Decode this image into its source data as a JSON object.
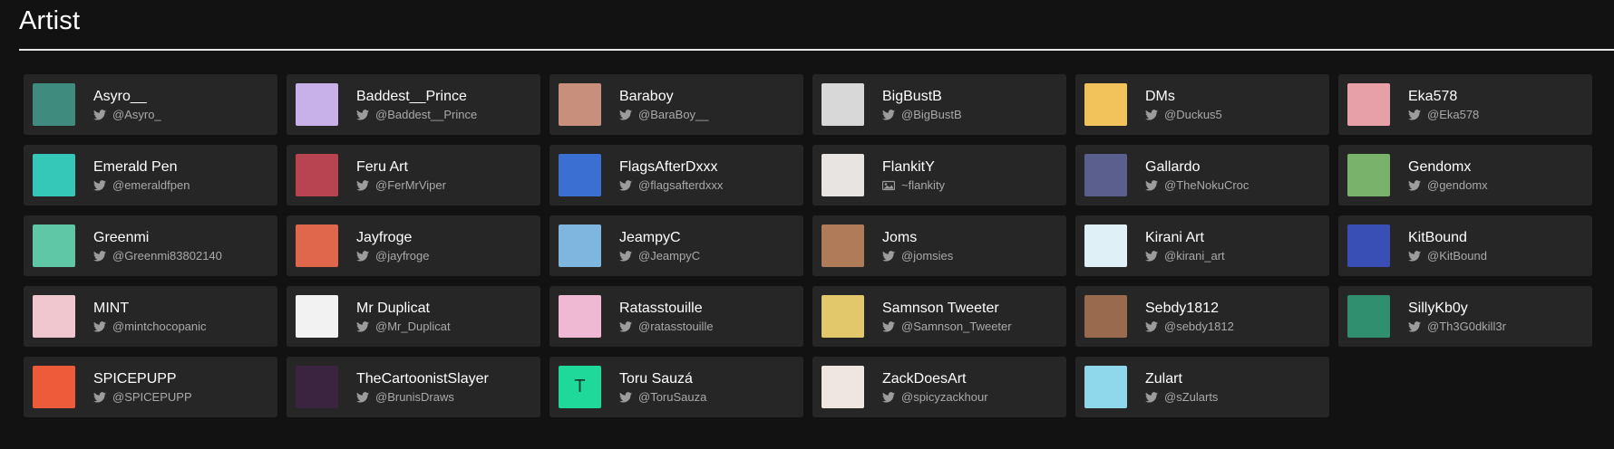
{
  "section": {
    "title": "Artist"
  },
  "colors": {
    "background": "#121212",
    "card": "#262626",
    "text": "#ffffff",
    "muted": "#a9a9a9"
  },
  "artists": [
    {
      "name": "Asyro__",
      "handle": "@Asyro_",
      "icon": "twitter-icon",
      "avatar": "#3f8b7d"
    },
    {
      "name": "Baddest__Prince",
      "handle": "@Baddest__Prince",
      "icon": "twitter-icon",
      "avatar": "#c8b0e8"
    },
    {
      "name": "Baraboy",
      "handle": "@BaraBoy__",
      "icon": "twitter-icon",
      "avatar": "#c98f7d"
    },
    {
      "name": "BigBustB",
      "handle": "@BigBustB",
      "icon": "twitter-icon",
      "avatar": "#d8d8d8"
    },
    {
      "name": "DMs",
      "handle": "@Duckus5",
      "icon": "twitter-icon",
      "avatar": "#f2c35a"
    },
    {
      "name": "Eka578",
      "handle": "@Eka578",
      "icon": "twitter-icon",
      "avatar": "#e7a0a8"
    },
    {
      "name": "Emerald Pen",
      "handle": "@emeraldfpen",
      "icon": "twitter-icon",
      "avatar": "#35c7b7"
    },
    {
      "name": "Feru Art",
      "handle": "@FerMrViper",
      "icon": "twitter-icon",
      "avatar": "#b84452"
    },
    {
      "name": "FlagsAfterDxxx",
      "handle": "@flagsafterdxxx",
      "icon": "twitter-icon",
      "avatar": "#3c6fd2"
    },
    {
      "name": "FlankitY",
      "handle": "~flankity",
      "icon": "gallery-icon",
      "avatar": "#e7e4e2"
    },
    {
      "name": "Gallardo",
      "handle": "@TheNokuCroc",
      "icon": "twitter-icon",
      "avatar": "#5a5f8d"
    },
    {
      "name": "Gendomx",
      "handle": "@gendomx",
      "icon": "twitter-icon",
      "avatar": "#79b26b"
    },
    {
      "name": "Greenmi",
      "handle": "@Greenmi83802140",
      "icon": "twitter-icon",
      "avatar": "#5fc6a6"
    },
    {
      "name": "Jayfroge",
      "handle": "@jayfroge",
      "icon": "twitter-icon",
      "avatar": "#e0664c"
    },
    {
      "name": "JeampyC",
      "handle": "@JeampyC",
      "icon": "twitter-icon",
      "avatar": "#7fb6e0"
    },
    {
      "name": "Joms",
      "handle": "@jomsies",
      "icon": "twitter-icon",
      "avatar": "#b07b58"
    },
    {
      "name": "Kirani Art",
      "handle": "@kirani_art",
      "icon": "twitter-icon",
      "avatar": "#dff0f7"
    },
    {
      "name": "KitBound",
      "handle": "@KitBound",
      "icon": "twitter-icon",
      "avatar": "#3a4fb5"
    },
    {
      "name": "MINT",
      "handle": "@mintchocopanic",
      "icon": "twitter-icon",
      "avatar": "#f0c6cf"
    },
    {
      "name": "Mr Duplicat",
      "handle": "@Mr_Duplicat",
      "icon": "twitter-icon",
      "avatar": "#f2f2f2"
    },
    {
      "name": "Ratasstouille",
      "handle": "@ratasstouille",
      "icon": "twitter-icon",
      "avatar": "#f0b9d3"
    },
    {
      "name": "Samnson Tweeter",
      "handle": "@Samnson_Tweeter",
      "icon": "twitter-icon",
      "avatar": "#e2c86a"
    },
    {
      "name": "Sebdy1812",
      "handle": "@sebdy1812",
      "icon": "twitter-icon",
      "avatar": "#9a6a4f"
    },
    {
      "name": "SillyKb0y",
      "handle": "@Th3G0dkill3r",
      "icon": "twitter-icon",
      "avatar": "#2f8f6e"
    },
    {
      "name": "SPICEPUPP",
      "handle": "@SPICEPUPP",
      "icon": "twitter-icon",
      "avatar": "#ee5b3b"
    },
    {
      "name": "TheCartoonistSlayer",
      "handle": "@BrunisDraws",
      "icon": "twitter-icon",
      "avatar": "#3a2440"
    },
    {
      "name": "Toru Sauzá",
      "handle": "@ToruSauza",
      "icon": "twitter-icon",
      "avatar": "#1ed99a",
      "initial": "T"
    },
    {
      "name": "ZackDoesArt",
      "handle": "@spicyzackhour",
      "icon": "twitter-icon",
      "avatar": "#efe6e1"
    },
    {
      "name": "Zulart",
      "handle": "@sZularts",
      "icon": "twitter-icon",
      "avatar": "#8fd7ea"
    }
  ]
}
